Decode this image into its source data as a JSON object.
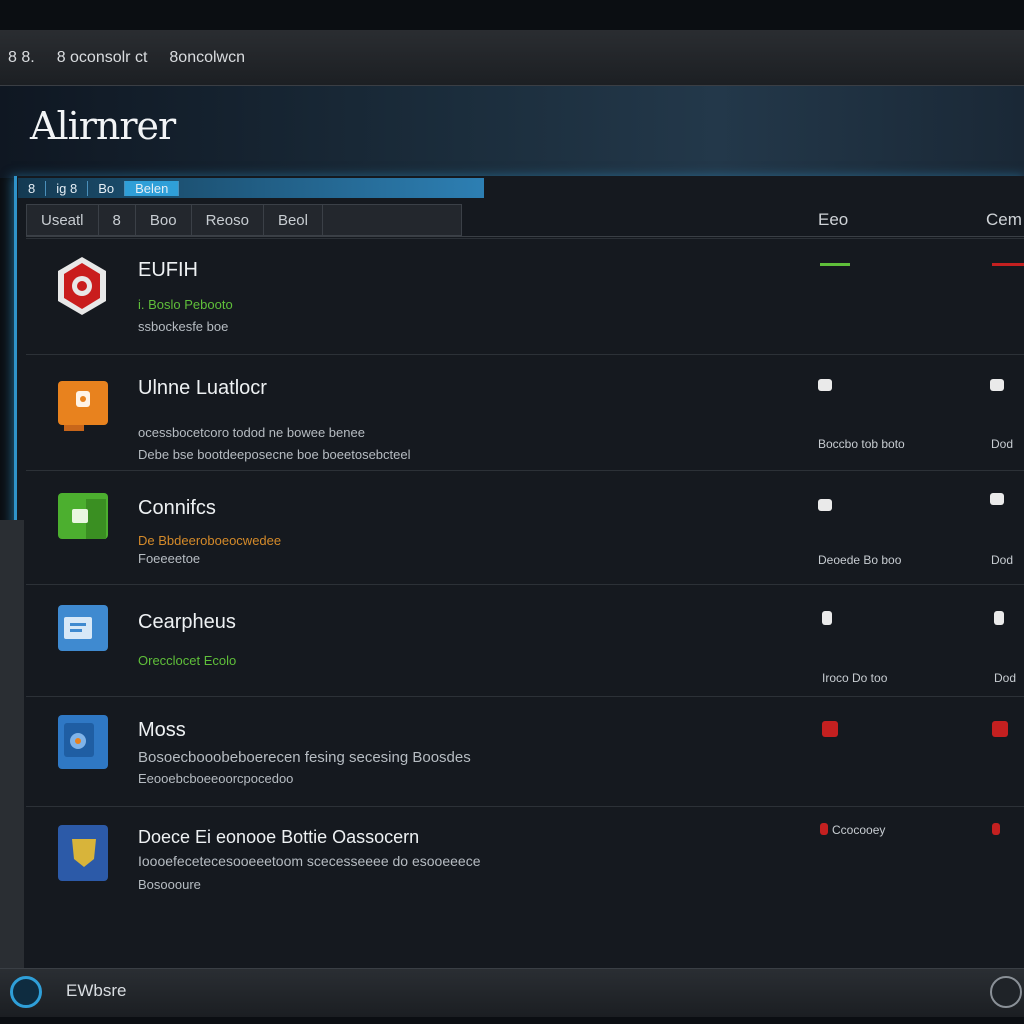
{
  "menubar": {
    "items": [
      "8 8.",
      "8 oconsolr ct",
      "8oncolwcn"
    ]
  },
  "app": {
    "title": "Alirnrer"
  },
  "topstrip": {
    "tabs": [
      "8",
      "ig 8",
      "Bo"
    ],
    "active_tab": "Belen"
  },
  "toolbar": {
    "tabs": [
      "Useatl",
      "8",
      "Boo",
      "Reoso",
      "Beol"
    ]
  },
  "columns": {
    "col1": "Eeo",
    "col2": "Cem"
  },
  "rows": [
    {
      "title": "EUFIH",
      "line1": "i. Boslo Pebooto",
      "line2": "ssbockesfe boe",
      "stat_a": "",
      "stat_b": ""
    },
    {
      "title": "Ulnne Luatlocr",
      "line1": "ocessbocetcoro todod ne bowee benee",
      "line2": "Debe bse bootdeeposecne boe boeetosebcteel",
      "stat_a": "Boccbo tob boto",
      "stat_b": "Dod"
    },
    {
      "title": "Connifcs",
      "line1": "De Bbdeeroboeocwedee",
      "line2": "Foeeeetoe",
      "stat_a": "Deoede Bo boo",
      "stat_b": "Dod"
    },
    {
      "title": "Cearpheus",
      "line1": "Orecclocet Ecolo",
      "line2": "",
      "stat_a": "Iroco Do too",
      "stat_b": "Dod"
    },
    {
      "title": "Moss",
      "line1": "Bosoecbooobeboerecen fesing secesing Boosdes",
      "line2": "Eeooebcboeeoorcpocedoo",
      "stat_a": "",
      "stat_b": ""
    },
    {
      "title": "Doece Ei eonooe Bottie Oassocern",
      "line1": "Ioooefecetecesooeeetoom scecesseeee do esooeeece",
      "line2": "Bosoooure",
      "stat_a": "Ccocooey",
      "stat_b": ""
    }
  ],
  "status": {
    "text": "EWbsre"
  },
  "colors": {
    "accent": "#2f93c9",
    "green": "#5fbf3a",
    "red": "#c42020",
    "orange": "#e8821e",
    "blue": "#2f78c4"
  }
}
